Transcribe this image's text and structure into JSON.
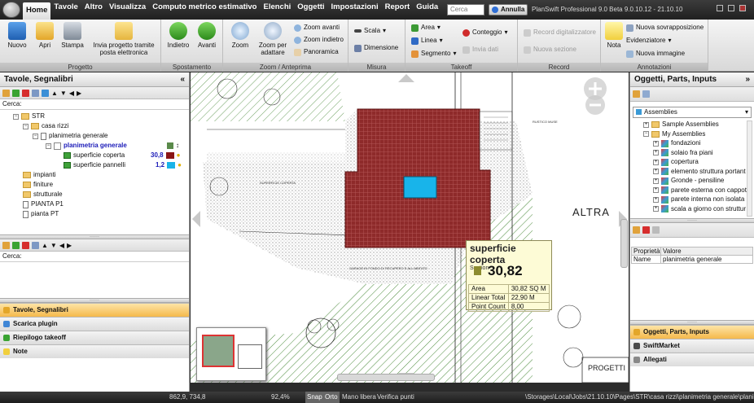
{
  "menu": {
    "items": [
      "Home",
      "Tavole",
      "Altro",
      "Visualizza",
      "Computo metrico estimativo",
      "Elenchi",
      "Oggetti",
      "Impostazioni",
      "Report",
      "Guida"
    ],
    "search_placeholder": "Cerca",
    "annulla": "Annulla",
    "app_title": "PlanSwift Professional 9.0 Beta  9.0.10.12 - 21.10.10"
  },
  "ribbon": {
    "progetto": {
      "label": "Progetto",
      "nuovo": "Nuovo",
      "apri": "Apri",
      "stampa": "Stampa",
      "invia": "Invia progetto tramite posta elettronica"
    },
    "spostamento": {
      "label": "Spostamento",
      "indietro": "Indietro",
      "avanti": "Avanti"
    },
    "zoom": {
      "label": "Zoom / Anteprima",
      "zoom": "Zoom",
      "zoom_adattare": "Zoom per adattare",
      "avanti": "Zoom avanti",
      "indietro": "Zoom indietro",
      "panoramica": "Panoramica"
    },
    "misura": {
      "label": "Misura",
      "scala": "Scala",
      "dimensione": "Dimensione"
    },
    "takeoff": {
      "label": "Takeoff",
      "area": "Area",
      "linea": "Linea",
      "segmento": "Segmento",
      "conteggio": "Conteggio",
      "invia_dati": "Invia dati"
    },
    "record": {
      "label": "Record",
      "record_digitalizzatore": "Record digitalizzatore",
      "nuova_sezione": "Nuova sezione"
    },
    "annotazioni": {
      "label": "Annotazioni",
      "nota": "Nota",
      "sovrapposizione": "Nuova sovrapposizione",
      "evidenziatore": "Evidenziatore",
      "nuova_immagine": "Nuova immagine"
    }
  },
  "left": {
    "title": "Tavole, Segnalibri",
    "cerca": "Cerca:",
    "tree": {
      "str": "STR",
      "casa": "casa rizzi",
      "planimetria": "planimetria generale",
      "planimetria_sel": "planimetria generale",
      "coperta": "superficie coperta",
      "coperta_val": "30,8",
      "pannelli": "superficie pannelli",
      "pannelli_val": "1,2",
      "impianti": "impianti",
      "finiture": "finiture",
      "strutturale": "strutturale",
      "pianta_p1": "PIANTA P1",
      "pianta_pt": "pianta PT"
    },
    "cerca2": "Cerca:",
    "nav": [
      "Tavole, Segnalibri",
      "Scarica plugin",
      "Riepilogo takeoff",
      "Note"
    ]
  },
  "canvas": {
    "altra": "ALTRA",
    "progetti": "PROGETTI",
    "label_a": "RUSTICO MUSE",
    "label_b": "SUPERFICIE COPERTA",
    "label_c": "GARAGE IN FONDO DI RECUPERO E ALL'ABITATO"
  },
  "tooltip": {
    "title": "superficie coperta",
    "section": "Section",
    "value": "30,82",
    "rows": [
      [
        "Area",
        "30,82 SQ M"
      ],
      [
        "Linear Total",
        "22,90 M"
      ],
      [
        "Point Count",
        "8,00"
      ]
    ]
  },
  "right": {
    "title": "Oggetti, Parts, Inputs",
    "dropdown": "Assemblies",
    "items": [
      "Sample Assemblies",
      "My Assemblies",
      "fondazioni",
      "solaio fra piani",
      "copertura",
      "elemento struttura portant",
      "Gronde - pensiline",
      "parete esterna con cappot",
      "parete interna non isolata",
      "scala  a giorno con struttur"
    ],
    "prop_header": [
      "Proprietà",
      "Valore"
    ],
    "prop_row": [
      "Name",
      "planimetria generale"
    ],
    "nav": [
      "Oggetti, Parts, Inputs",
      "SwiftMarket",
      "Allegati"
    ]
  },
  "status": {
    "coords": "862,9, 734,8",
    "zoom": "92,4%",
    "snap": "Snap",
    "orto": "Orto",
    "mano": "Mano libera",
    "verifica": "Verifica punti",
    "path": "\\Storages\\Local\\Jobs\\21.10.10\\Pages\\STR\\casa rizzi\\planimetria generale\\planimetria"
  }
}
